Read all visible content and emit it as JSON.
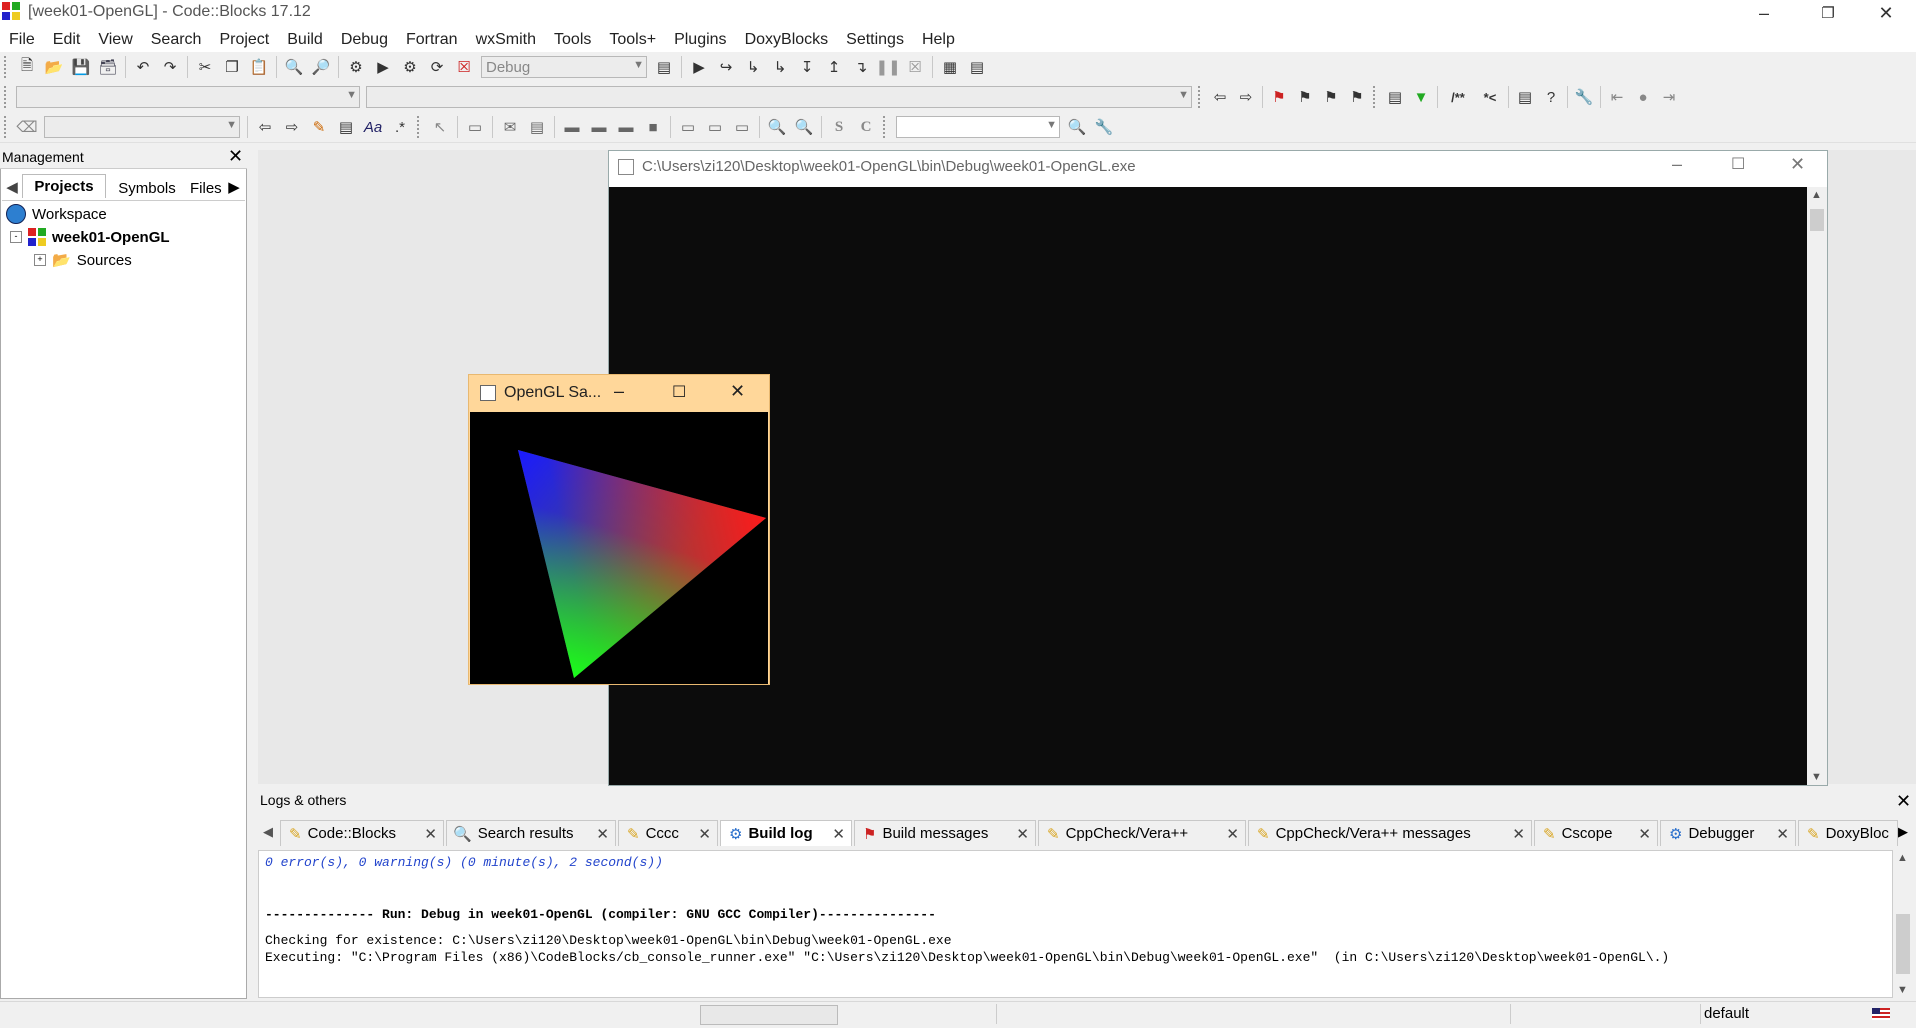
{
  "window": {
    "title": "[week01-OpenGL] - Code::Blocks 17.12"
  },
  "menu": [
    "File",
    "Edit",
    "View",
    "Search",
    "Project",
    "Build",
    "Debug",
    "Fortran",
    "wxSmith",
    "Tools",
    "Tools+",
    "Plugins",
    "DoxyBlocks",
    "Settings",
    "Help"
  ],
  "toolbar": {
    "build_target": "Debug"
  },
  "management": {
    "title": "Management",
    "tabs": [
      "Projects",
      "Symbols",
      "Files"
    ],
    "tree": {
      "workspace": "Workspace",
      "project": "week01-OpenGL",
      "folder": "Sources"
    }
  },
  "console": {
    "title": "C:\\Users\\zi120\\Desktop\\week01-OpenGL\\bin\\Debug\\week01-OpenGL.exe"
  },
  "glwindow": {
    "title": "OpenGL Sa..."
  },
  "logs": {
    "title": "Logs & others",
    "tabs": [
      "Code::Blocks",
      "Search results",
      "Cccc",
      "Build log",
      "Build messages",
      "CppCheck/Vera++",
      "CppCheck/Vera++ messages",
      "Cscope",
      "Debugger",
      "DoxyBloc"
    ],
    "active_tab": "Build log",
    "lines": [
      "0 error(s), 0 warning(s) (0 minute(s), 2 second(s))",
      "-------------- Run: Debug in week01-OpenGL (compiler: GNU GCC Compiler)---------------",
      "Checking for existence: C:\\Users\\zi120\\Desktop\\week01-OpenGL\\bin\\Debug\\week01-OpenGL.exe",
      "Executing: \"C:\\Program Files (x86)\\CodeBlocks/cb_console_runner.exe\" \"C:\\Users\\zi120\\Desktop\\week01-OpenGL\\bin\\Debug\\week01-OpenGL.exe\"  (in C:\\Users\\zi120\\Desktop\\week01-OpenGL\\.)"
    ]
  },
  "status": {
    "profile": "default"
  },
  "colors": {
    "gl_title_bg": "#ffd79a",
    "log_info": "#2244cc",
    "console_bg": "#0c0c0c"
  }
}
